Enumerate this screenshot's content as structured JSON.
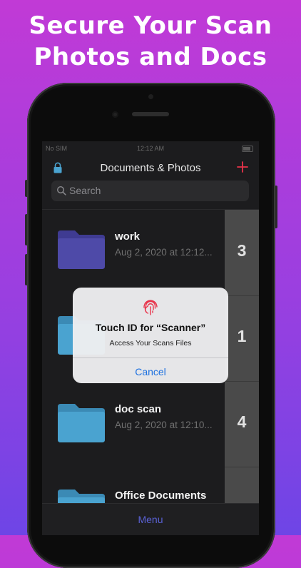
{
  "headline": {
    "line1": "Secure Your Scan",
    "line2": "Photos and Docs"
  },
  "status_bar": {
    "carrier": "No SIM",
    "time": "12:12 AM"
  },
  "nav": {
    "title": "Documents & Photos",
    "left_icon": "lock-icon",
    "right_icon": "plus-icon"
  },
  "search": {
    "placeholder": "Search"
  },
  "folders": [
    {
      "name": "work",
      "date": "Aug 2, 2020 at 12:12...",
      "count": "3",
      "color": "#4e4aa8"
    },
    {
      "name": "",
      "date": "",
      "count": "1",
      "color": "#4aa3d0"
    },
    {
      "name": "doc scan",
      "date": "Aug 2, 2020 at 12:10...",
      "count": "4",
      "color": "#4aa3d0"
    },
    {
      "name": "Office Documents",
      "date": "",
      "count": "",
      "color": "#4aa3d0"
    }
  ],
  "alert": {
    "title": "Touch ID for “Scanner”",
    "message": "Access Your Scans Files",
    "cancel_label": "Cancel",
    "icon": "fingerprint-icon"
  },
  "tab_bar": {
    "menu_label": "Menu"
  },
  "colors": {
    "accent": "#e8334a",
    "link": "#1f72e0",
    "tab": "#5a62d6"
  }
}
